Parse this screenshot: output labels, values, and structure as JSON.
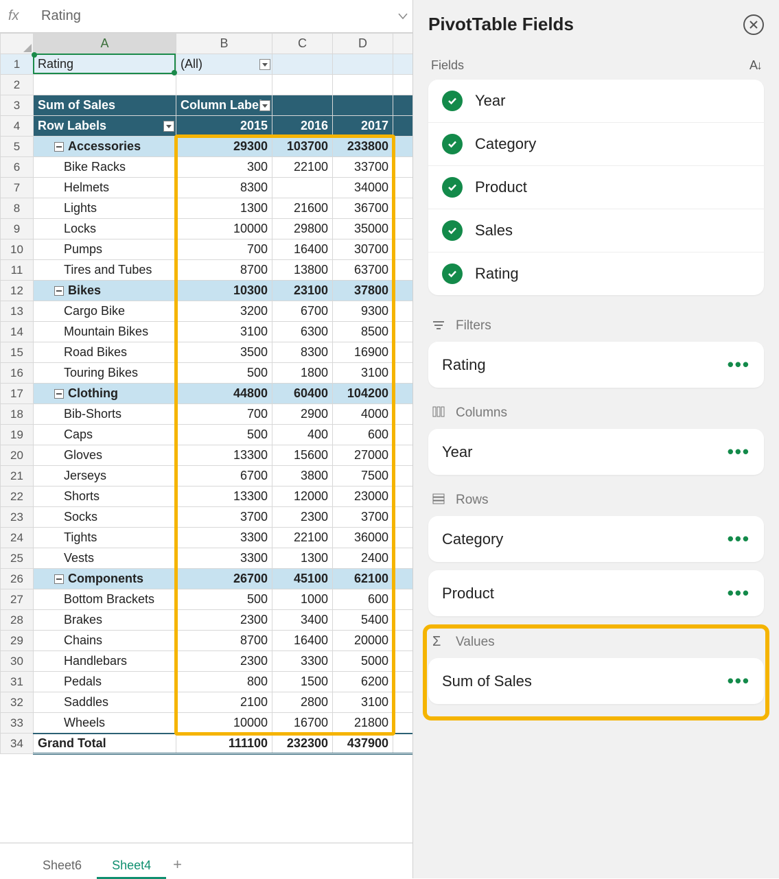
{
  "formula_bar": {
    "fx": "fx",
    "value": "Rating"
  },
  "columns": [
    "A",
    "B",
    "C",
    "D"
  ],
  "row_numbers": [
    1,
    2,
    3,
    4,
    5,
    6,
    7,
    8,
    9,
    10,
    11,
    12,
    13,
    14,
    15,
    16,
    17,
    18,
    19,
    20,
    21,
    22,
    23,
    24,
    25,
    26,
    27,
    28,
    29,
    30,
    31,
    32,
    33,
    34
  ],
  "pivot": {
    "filter_label": "Rating",
    "filter_value": "(All)",
    "measure": "Sum of Sales",
    "col_label": "Column Labels",
    "row_label": "Row Labels",
    "years": [
      "2015",
      "2016",
      "2017"
    ],
    "grand_label": "Grand Total",
    "grand": [
      111100,
      232300,
      437900
    ],
    "groups": [
      {
        "name": "Accessories",
        "tot": [
          29300,
          103700,
          233800
        ],
        "rows": [
          {
            "n": "Bike Racks",
            "v": [
              300,
              22100,
              33700
            ]
          },
          {
            "n": "Helmets",
            "v": [
              8300,
              null,
              34000
            ]
          },
          {
            "n": "Lights",
            "v": [
              1300,
              21600,
              36700
            ]
          },
          {
            "n": "Locks",
            "v": [
              10000,
              29800,
              35000
            ]
          },
          {
            "n": "Pumps",
            "v": [
              700,
              16400,
              30700
            ]
          },
          {
            "n": "Tires and Tubes",
            "v": [
              8700,
              13800,
              63700
            ]
          }
        ]
      },
      {
        "name": "Bikes",
        "tot": [
          10300,
          23100,
          37800
        ],
        "rows": [
          {
            "n": "Cargo Bike",
            "v": [
              3200,
              6700,
              9300
            ]
          },
          {
            "n": "Mountain Bikes",
            "v": [
              3100,
              6300,
              8500
            ]
          },
          {
            "n": "Road Bikes",
            "v": [
              3500,
              8300,
              16900
            ]
          },
          {
            "n": "Touring Bikes",
            "v": [
              500,
              1800,
              3100
            ]
          }
        ]
      },
      {
        "name": "Clothing",
        "tot": [
          44800,
          60400,
          104200
        ],
        "rows": [
          {
            "n": "Bib-Shorts",
            "v": [
              700,
              2900,
              4000
            ]
          },
          {
            "n": "Caps",
            "v": [
              500,
              400,
              600
            ]
          },
          {
            "n": "Gloves",
            "v": [
              13300,
              15600,
              27000
            ]
          },
          {
            "n": "Jerseys",
            "v": [
              6700,
              3800,
              7500
            ]
          },
          {
            "n": "Shorts",
            "v": [
              13300,
              12000,
              23000
            ]
          },
          {
            "n": "Socks",
            "v": [
              3700,
              2300,
              3700
            ]
          },
          {
            "n": "Tights",
            "v": [
              3300,
              22100,
              36000
            ]
          },
          {
            "n": "Vests",
            "v": [
              3300,
              1300,
              2400
            ]
          }
        ]
      },
      {
        "name": "Components",
        "tot": [
          26700,
          45100,
          62100
        ],
        "rows": [
          {
            "n": "Bottom Brackets",
            "v": [
              500,
              1000,
              600
            ]
          },
          {
            "n": "Brakes",
            "v": [
              2300,
              3400,
              5400
            ]
          },
          {
            "n": "Chains",
            "v": [
              8700,
              16400,
              20000
            ]
          },
          {
            "n": "Handlebars",
            "v": [
              2300,
              3300,
              5000
            ]
          },
          {
            "n": "Pedals",
            "v": [
              800,
              1500,
              6200
            ]
          },
          {
            "n": "Saddles",
            "v": [
              2100,
              2800,
              3100
            ]
          },
          {
            "n": "Wheels",
            "v": [
              10000,
              16700,
              21800
            ]
          }
        ]
      }
    ]
  },
  "tabs": {
    "inactive": "Sheet6",
    "active": "Sheet4"
  },
  "pane": {
    "title": "PivotTable Fields",
    "fields_label": "Fields",
    "fields": [
      "Year",
      "Category",
      "Product",
      "Sales",
      "Rating"
    ],
    "sections": {
      "filters": {
        "label": "Filters",
        "items": [
          "Rating"
        ]
      },
      "columns": {
        "label": "Columns",
        "items": [
          "Year"
        ]
      },
      "rows": {
        "label": "Rows",
        "items": [
          "Category",
          "Product"
        ]
      },
      "values": {
        "label": "Values",
        "items": [
          "Sum of Sales"
        ]
      }
    }
  }
}
